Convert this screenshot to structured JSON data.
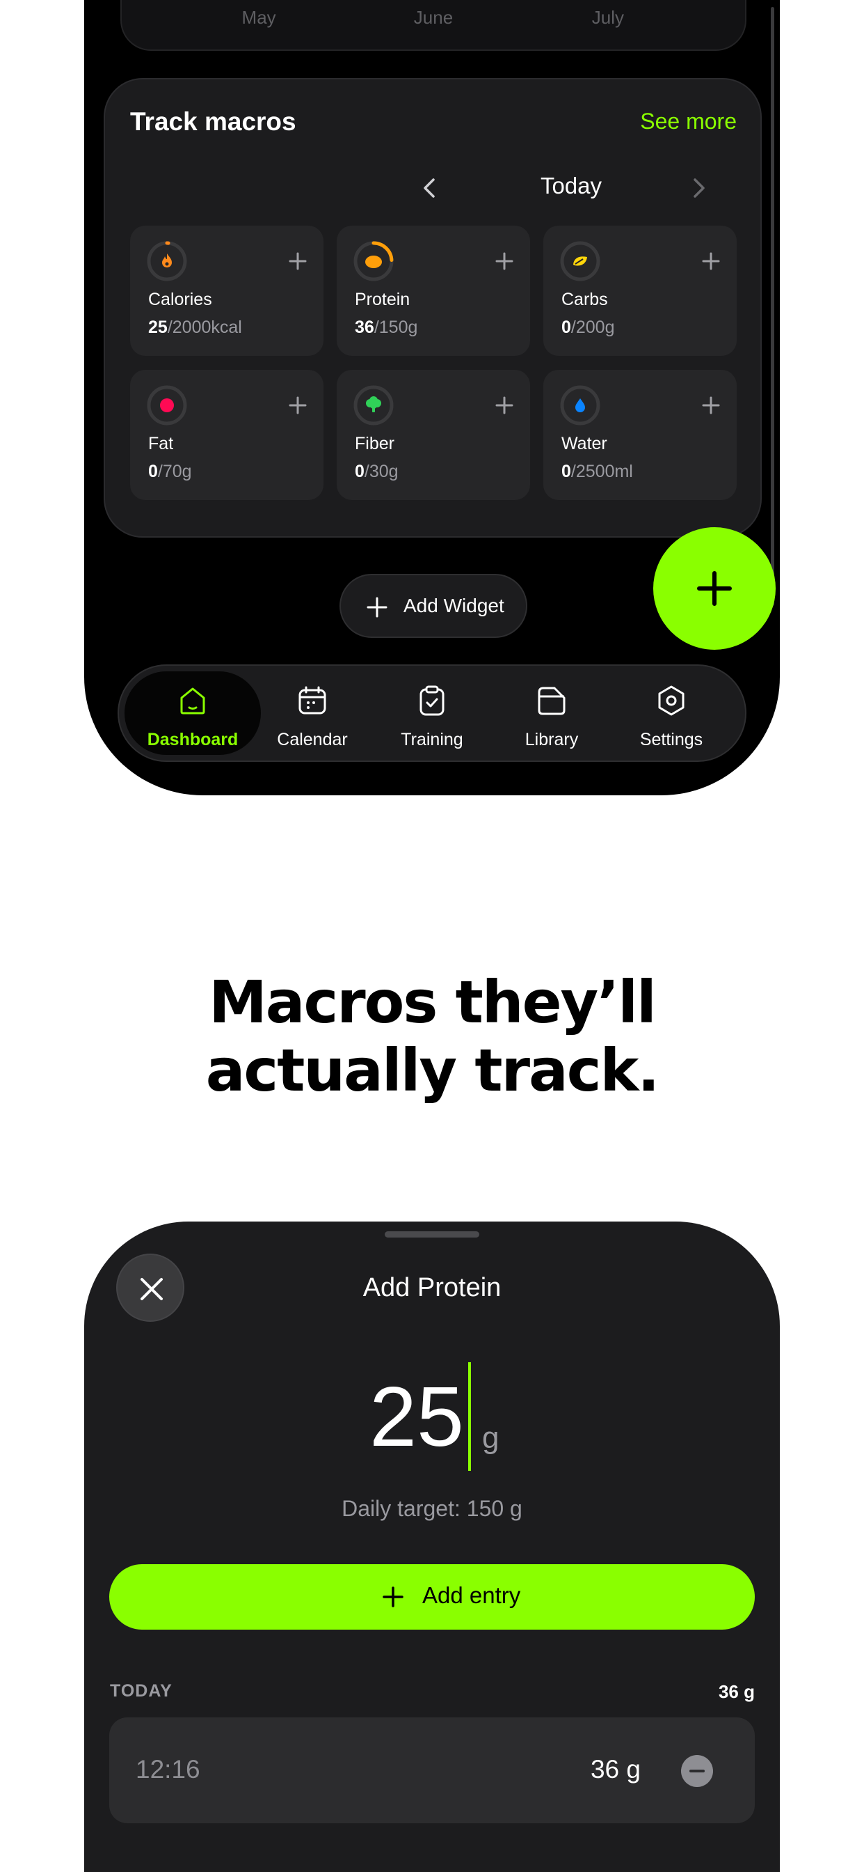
{
  "months": [
    "May",
    "June",
    "July"
  ],
  "macros_card": {
    "title": "Track macros",
    "see_more": "See more",
    "date": "Today"
  },
  "tiles": [
    {
      "name": "Calories",
      "value": "25",
      "target": "/2000kcal",
      "color": "#ff8a1c",
      "icon": "flame-icon",
      "progress": 0.0125
    },
    {
      "name": "Protein",
      "value": "36",
      "target": "/150g",
      "color": "#ff9f0a",
      "icon": "egg-icon",
      "progress": 0.24
    },
    {
      "name": "Carbs",
      "value": "0",
      "target": "/200g",
      "color": "#ffd60a",
      "icon": "leaf-icon",
      "progress": 0
    },
    {
      "name": "Fat",
      "value": "0",
      "target": "/70g",
      "color": "#ff0a54",
      "icon": "dot-icon",
      "progress": 0
    },
    {
      "name": "Fiber",
      "value": "0",
      "target": "/30g",
      "color": "#30d158",
      "icon": "tree-icon",
      "progress": 0
    },
    {
      "name": "Water",
      "value": "0",
      "target": "/2500ml",
      "color": "#0a84ff",
      "icon": "droplet-icon",
      "progress": 0
    }
  ],
  "add_widget": "Add Widget",
  "tabs": [
    {
      "label": "Dashboard",
      "icon": "home-icon",
      "active": true
    },
    {
      "label": "Calendar",
      "icon": "calendar-icon",
      "active": false
    },
    {
      "label": "Training",
      "icon": "clipboard-check-icon",
      "active": false
    },
    {
      "label": "Library",
      "icon": "folder-icon",
      "active": false
    },
    {
      "label": "Settings",
      "icon": "hexagon-gear-icon",
      "active": false
    }
  ],
  "headline": {
    "line1": "Macros they’ll",
    "line2": "actually track."
  },
  "sheet": {
    "title": "Add Protein",
    "amount": "25",
    "unit": "g",
    "daily_target": "Daily target: 150 g",
    "add_entry": "Add entry",
    "section_label": "TODAY",
    "section_total": "36 g",
    "entries": [
      {
        "time": "12:16",
        "amount": "36 g"
      }
    ]
  },
  "colors": {
    "accent": "#8aff00",
    "background": "#000000",
    "card": "#1c1c1e"
  }
}
